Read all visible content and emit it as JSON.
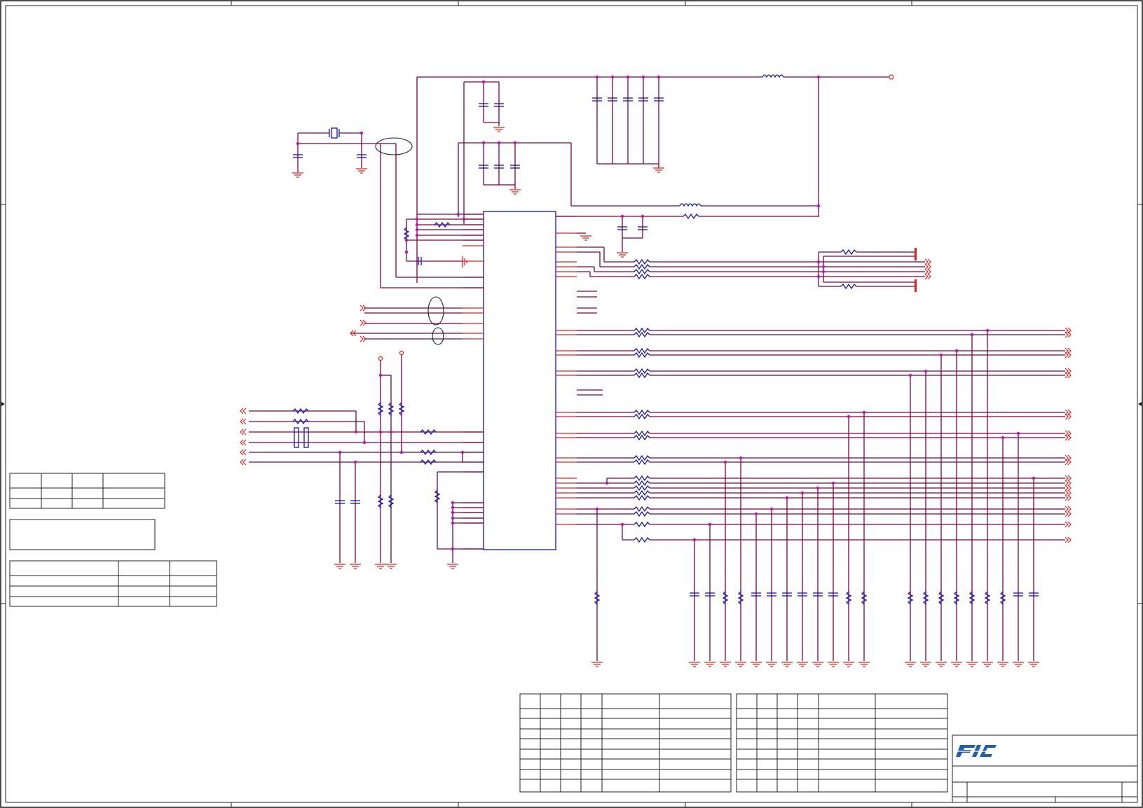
{
  "sheet": {
    "type": "schematic",
    "ui_colors": {
      "wire": "#800040",
      "pin": "#e8201a",
      "component": "#1010d0",
      "junction": "#c010c0",
      "border": "#202020",
      "logo": "#1f5fa8"
    }
  },
  "title_block": {
    "logo_text": "FIC",
    "logo_icon": "fic-logo-icon"
  }
}
